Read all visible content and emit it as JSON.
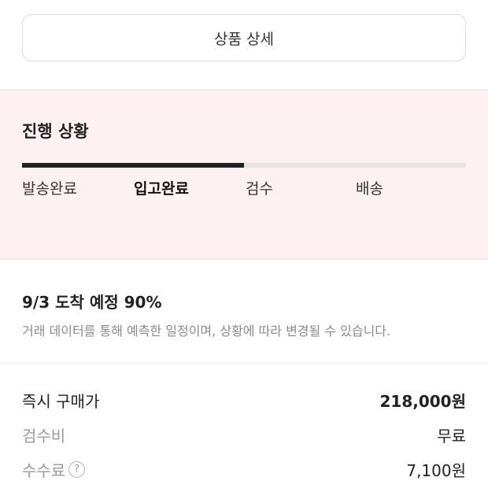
{
  "product_detail": {
    "button_label": "상품 상세"
  },
  "progress": {
    "title": "진행 상황",
    "fill_fraction": 0.5,
    "steps": [
      "발송완료",
      "입고완료",
      "검수",
      "배송"
    ],
    "active_step": "입고완료"
  },
  "arrival": {
    "title": "9/3 도착 예정 90%",
    "description": "거래 데이터를 통해 예측한 일정이며, 상황에 따라 변경될 수 있습니다."
  },
  "prices": {
    "instant_buy": {
      "label": "즉시 구매가",
      "value": "218,000원"
    },
    "inspection_fee": {
      "label": "검수비",
      "value": "무료"
    },
    "commission": {
      "label": "수수료",
      "value": "7,100원",
      "help_icon": "question-circle-icon"
    }
  },
  "colors": {
    "progress_bg": "#fdf2f1",
    "progress_fill": "#222222",
    "progress_track": "#e8e4e3"
  }
}
